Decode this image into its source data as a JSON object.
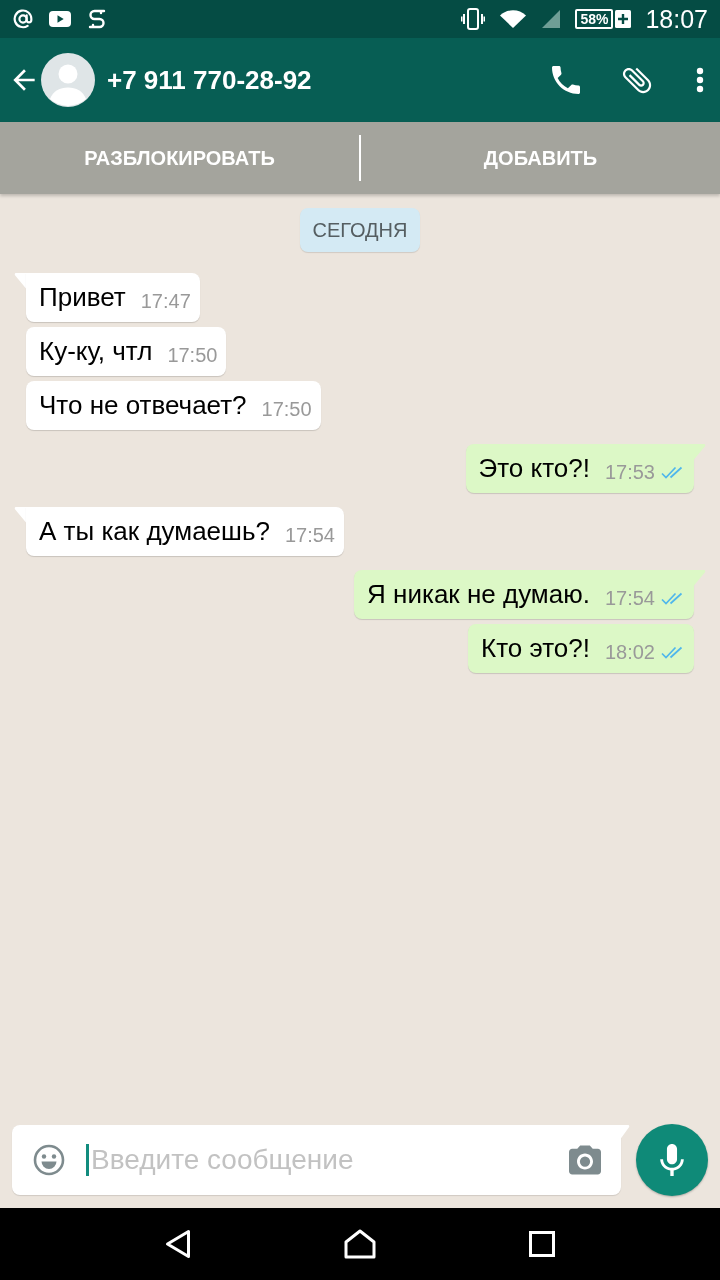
{
  "status_bar": {
    "battery": "58%",
    "time": "18:07"
  },
  "header": {
    "title": "+7 911 770-28-92"
  },
  "action_bar": {
    "buttons": [
      "РАЗБЛОКИРОВАТЬ",
      "ДОБАВИТЬ"
    ]
  },
  "chat": {
    "date": "СЕГОДНЯ",
    "messages": [
      {
        "kind": "incoming",
        "tail": true,
        "text": "Привет",
        "time": "17:47"
      },
      {
        "kind": "incoming",
        "tail": false,
        "text": "Ку-ку, чтл",
        "time": "17:50"
      },
      {
        "kind": "incoming",
        "tail": false,
        "text": "Что не отвечает?",
        "time": "17:50"
      },
      {
        "kind": "outgoing",
        "tail": true,
        "text": "Это кто?!",
        "time": "17:53",
        "read": true
      },
      {
        "kind": "incoming",
        "tail": true,
        "text": "А ты как думаешь?",
        "time": "17:54"
      },
      {
        "kind": "outgoing",
        "tail": true,
        "text": "Я никак не думаю.",
        "time": "17:54",
        "read": true
      },
      {
        "kind": "outgoing",
        "tail": false,
        "text": "Кто это?!",
        "time": "18:02",
        "read": true
      }
    ]
  },
  "composer": {
    "placeholder": "Введите сообщение"
  }
}
